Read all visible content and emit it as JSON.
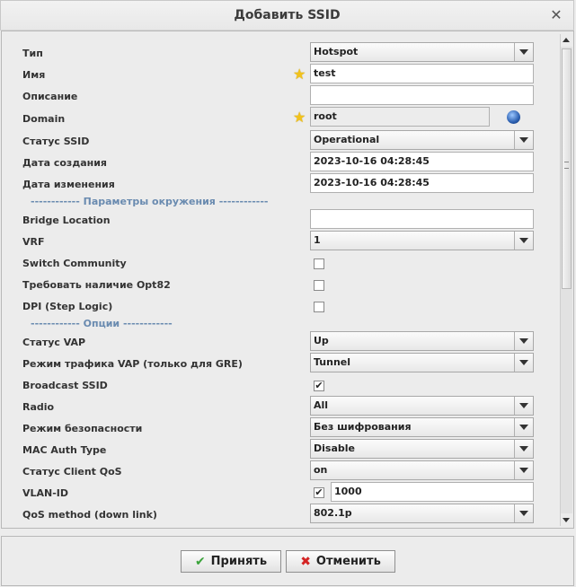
{
  "window": {
    "title": "Добавить SSID"
  },
  "fields": {
    "type": {
      "label": "Тип",
      "value": "Hotspot"
    },
    "name": {
      "label": "Имя",
      "value": "test"
    },
    "description": {
      "label": "Описание",
      "value": ""
    },
    "domain": {
      "label": "Domain",
      "value": "root"
    },
    "ssid_status": {
      "label": "Статус SSID",
      "value": "Operational"
    },
    "created": {
      "label": "Дата создания",
      "value": "2023-10-16 04:28:45"
    },
    "modified": {
      "label": "Дата изменения",
      "value": "2023-10-16 04:28:45"
    }
  },
  "env_section": "------------ Параметры окружения ------------",
  "env": {
    "bridge_location": {
      "label": "Bridge Location",
      "value": ""
    },
    "vrf": {
      "label": "VRF",
      "value": "1"
    },
    "switch_community": {
      "label": "Switch Community",
      "checked": false
    },
    "opt82": {
      "label": "Требовать наличие Opt82",
      "checked": false
    },
    "dpi": {
      "label": "DPI (Step Logic)",
      "checked": false
    }
  },
  "options_section": "------------ Опции ------------",
  "options": {
    "vap_status": {
      "label": "Статус VAP",
      "value": "Up"
    },
    "vap_mode": {
      "label": "Режим трафика VAP (только для GRE)",
      "value": "Tunnel"
    },
    "broadcast_ssid": {
      "label": "Broadcast SSID",
      "checked": true,
      "mark": "✔"
    },
    "radio": {
      "label": "Radio",
      "value": "All"
    },
    "security": {
      "label": "Режим безопасности",
      "value": "Без шифрования"
    },
    "mac_auth": {
      "label": "MAC Auth Type",
      "value": "Disable"
    },
    "client_qos": {
      "label": "Статус Client QoS",
      "value": "on"
    },
    "vlan_id": {
      "label": "VLAN-ID",
      "checked": true,
      "mark": "✔",
      "value": "1000"
    },
    "qos_method": {
      "label": "QoS method (down link)",
      "value": "802.1p"
    }
  },
  "buttons": {
    "ok": "Принять",
    "cancel": "Отменить"
  },
  "colors": {
    "section": "#6a8bb0",
    "star": "#f2c21b",
    "ok_icon": "#3aa33a",
    "cancel_icon": "#d42424"
  }
}
